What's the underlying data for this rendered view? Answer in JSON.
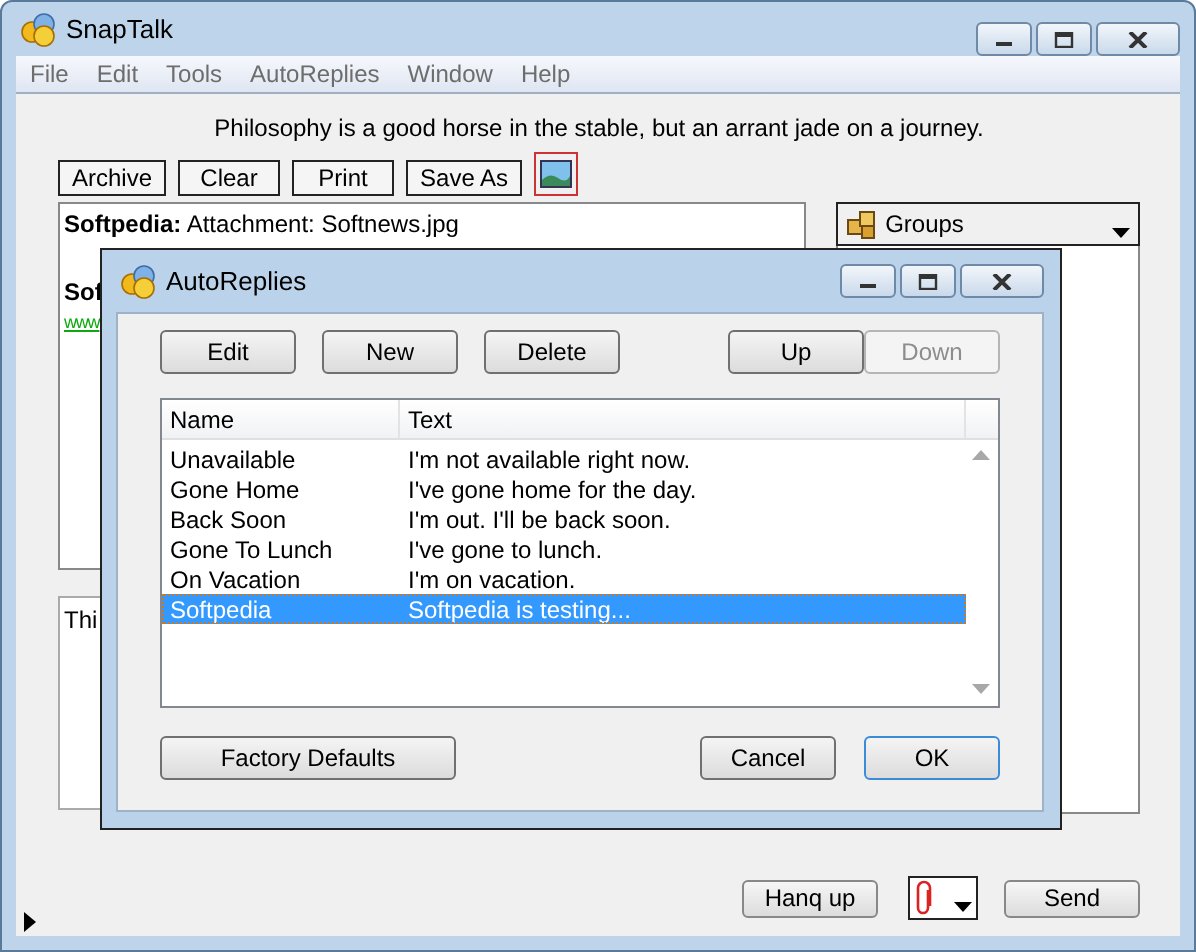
{
  "window": {
    "title": "SnapTalk"
  },
  "menu": [
    "File",
    "Edit",
    "Tools",
    "AutoReplies",
    "Window",
    "Help"
  ],
  "quote": "Philosophy is a good horse in the stable, but an arrant jade on a journey.",
  "toolbar": [
    "Archive",
    "Clear",
    "Print",
    "Save As"
  ],
  "chat": {
    "messages": [
      {
        "sender": "Softpedia:",
        "text": "Attachment: Softnews.jpg"
      }
    ],
    "partial_sender": "Sof",
    "partial_link": "www"
  },
  "input": {
    "value": "Thi"
  },
  "groups": {
    "label": "Groups"
  },
  "hangup_button": "Hanq up",
  "send_button": "Send",
  "dialog": {
    "title": "AutoReplies",
    "edit_buttons": [
      {
        "label": "Edit",
        "disabled": false
      },
      {
        "label": "New",
        "disabled": false
      },
      {
        "label": "Delete",
        "disabled": false
      }
    ],
    "order_buttons": [
      {
        "label": "Up",
        "disabled": false
      },
      {
        "label": "Down",
        "disabled": true
      }
    ],
    "columns": [
      "Name",
      "Text"
    ],
    "rows": [
      {
        "name": "Unavailable",
        "text": "I'm not available right now.",
        "selected": false
      },
      {
        "name": "Gone Home",
        "text": "I've gone home for the day.",
        "selected": false
      },
      {
        "name": "Back Soon",
        "text": "I'm out.  I'll be back soon.",
        "selected": false
      },
      {
        "name": "Gone To Lunch",
        "text": "I've gone to lunch.",
        "selected": false
      },
      {
        "name": "On Vacation",
        "text": "I'm on vacation.",
        "selected": false
      },
      {
        "name": "Softpedia",
        "text": "Softpedia is testing...",
        "selected": true
      }
    ],
    "defaults_button": "Factory Defaults",
    "cancel_button": "Cancel",
    "ok_button": "OK"
  }
}
